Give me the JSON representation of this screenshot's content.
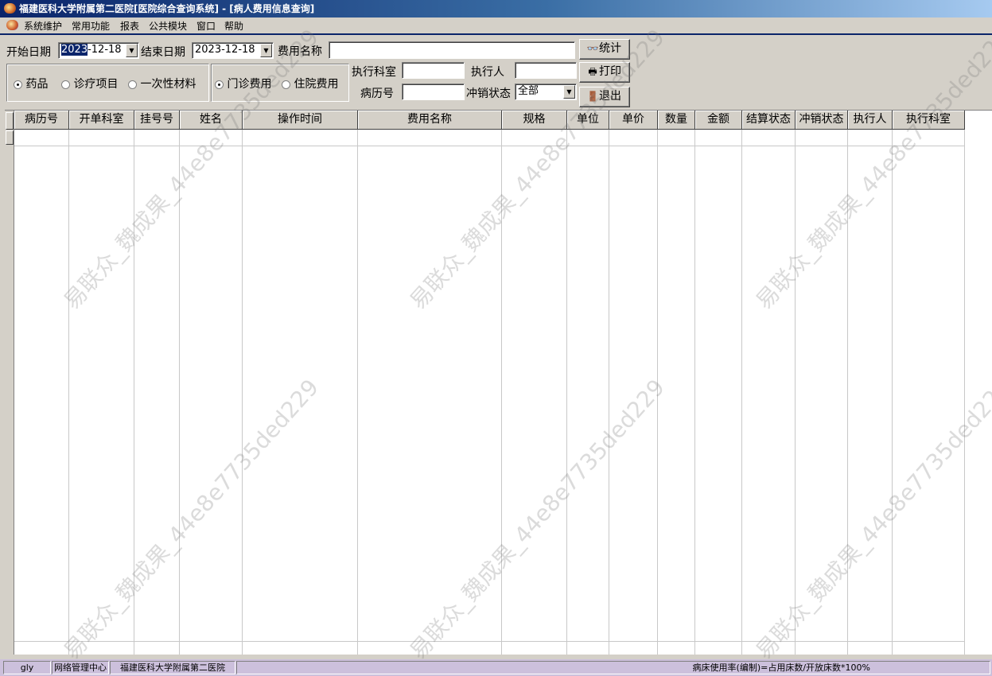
{
  "window": {
    "title": "福建医科大学附属第二医院[医院综合查询系统] - [病人费用信息查询]"
  },
  "menu": [
    "系统维护",
    "常用功能",
    "报表",
    "公共模块",
    "窗口",
    "帮助"
  ],
  "filters": {
    "start_date_label": "开始日期",
    "start_date_sel": "2023",
    "start_date_rest": "-12-18",
    "end_date_label": "结束日期",
    "end_date": "2023-12-18",
    "fee_name_label": "费用名称",
    "fee_name_value": "",
    "exec_dept_label": "执行科室",
    "exec_dept_value": "",
    "executor_label": "执行人",
    "executor_value": "",
    "record_no_label": "病历号",
    "record_no_value": "",
    "reverse_status_label": "冲销状态",
    "reverse_status_value": "全部"
  },
  "item_type": {
    "options": [
      "药品",
      "诊疗项目",
      "一次性材料"
    ],
    "selected": "药品"
  },
  "fee_type": {
    "options": [
      "门诊费用",
      "住院费用"
    ],
    "selected": "门诊费用"
  },
  "buttons": {
    "stats": "统计",
    "print": "打印",
    "exit": "退出"
  },
  "icons": {
    "stats": "binoculars-icon",
    "print": "printer-icon",
    "exit": "exit-door-icon"
  },
  "table": {
    "columns": [
      "病历号",
      "开单科室",
      "挂号号",
      "姓名",
      "操作时间",
      "费用名称",
      "规格",
      "单位",
      "单价",
      "数量",
      "金额",
      "结算状态",
      "冲销状态",
      "执行人",
      "执行科室"
    ],
    "rows": []
  },
  "status": {
    "user": "gly",
    "department": "网络管理中心",
    "hospital": "福建医科大学附属第二医院",
    "message": "病床使用率(编制)=占用床数/开放床数*100%"
  },
  "watermark": "易联众_魏成果_44e8e7735ded229",
  "colors": {
    "titlebar": "#0a246a",
    "window_bg": "#d4d0c8",
    "statusbar": "#ccc0dc"
  }
}
